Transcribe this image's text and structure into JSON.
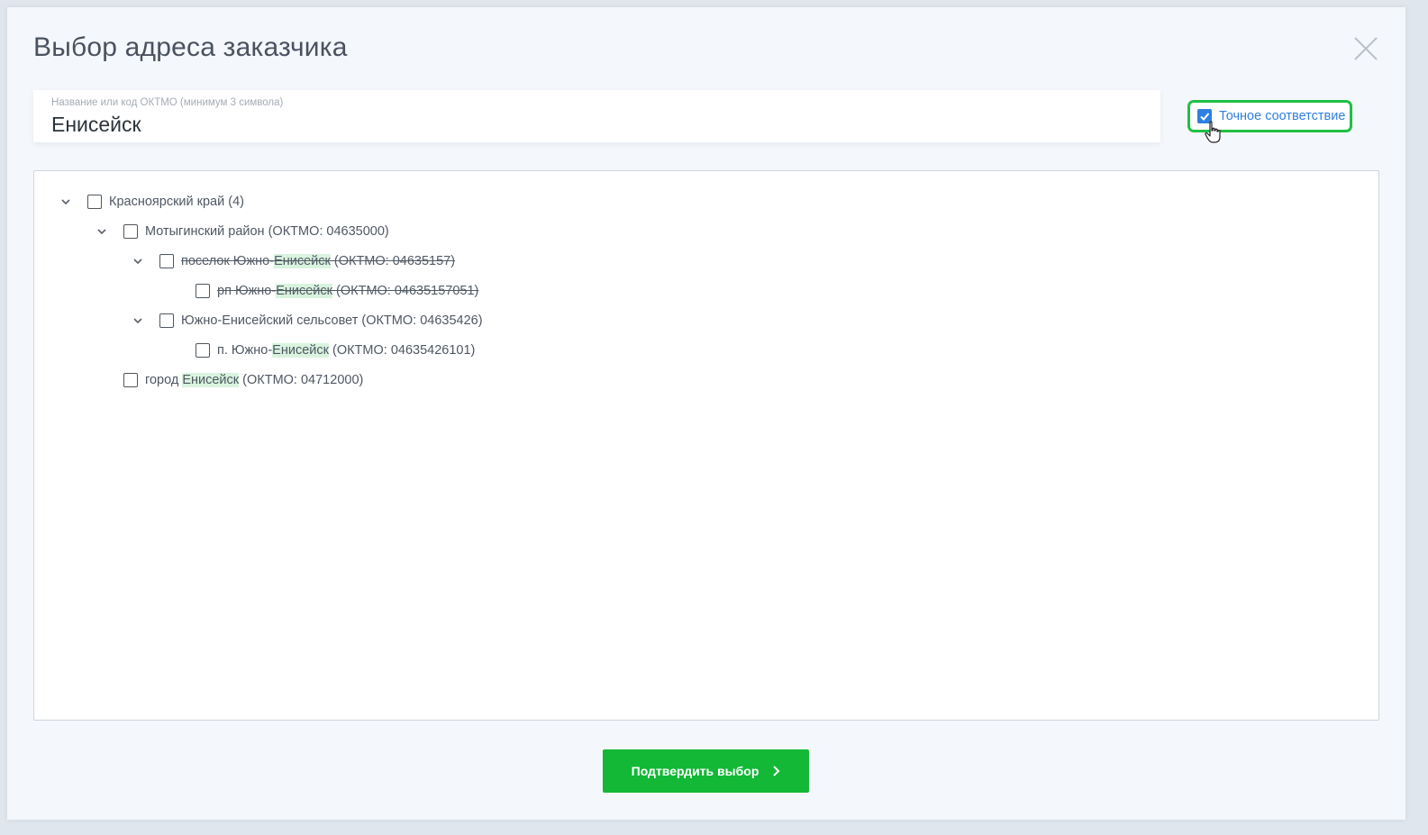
{
  "dialog": {
    "title": "Выбор адреса заказчика"
  },
  "search": {
    "label": "Название или код ОКТМО (минимум 3 символа)",
    "value": "Енисейск"
  },
  "exact_match": {
    "label": "Точное соответствие",
    "checked": true
  },
  "tree": {
    "nodes": [
      {
        "text": "Красноярский край (4)"
      },
      {
        "text": "Мотыгинский район (ОКТМО: 04635000)"
      },
      {
        "pre": "поселок Южно-",
        "hl": "Енисейск",
        "post": " (ОКТМО: 04635157)"
      },
      {
        "pre": "рп Южно-",
        "hl": "Енисейск",
        "post": " (ОКТМО: 04635157051)"
      },
      {
        "text": "Южно-Енисейский сельсовет (ОКТМО: 04635426)"
      },
      {
        "pre": "п. Южно-",
        "hl": "Енисейск",
        "post": " (ОКТМО: 04635426101)"
      },
      {
        "pre": "город ",
        "hl": "Енисейск",
        "post": " (ОКТМО: 04712000)"
      }
    ]
  },
  "confirm": {
    "label": "Подтвердить выбор"
  },
  "colors": {
    "accent_green": "#12b836",
    "checkbox_blue": "#2f7fe0",
    "highlight": "#d9f3df",
    "focus_ring": "#1fc045"
  },
  "icons": {
    "close": "close-icon",
    "chevron": "chevron-down-icon",
    "check": "check-icon",
    "arrow": "chevron-right-icon",
    "cursor": "hand-cursor-icon"
  }
}
